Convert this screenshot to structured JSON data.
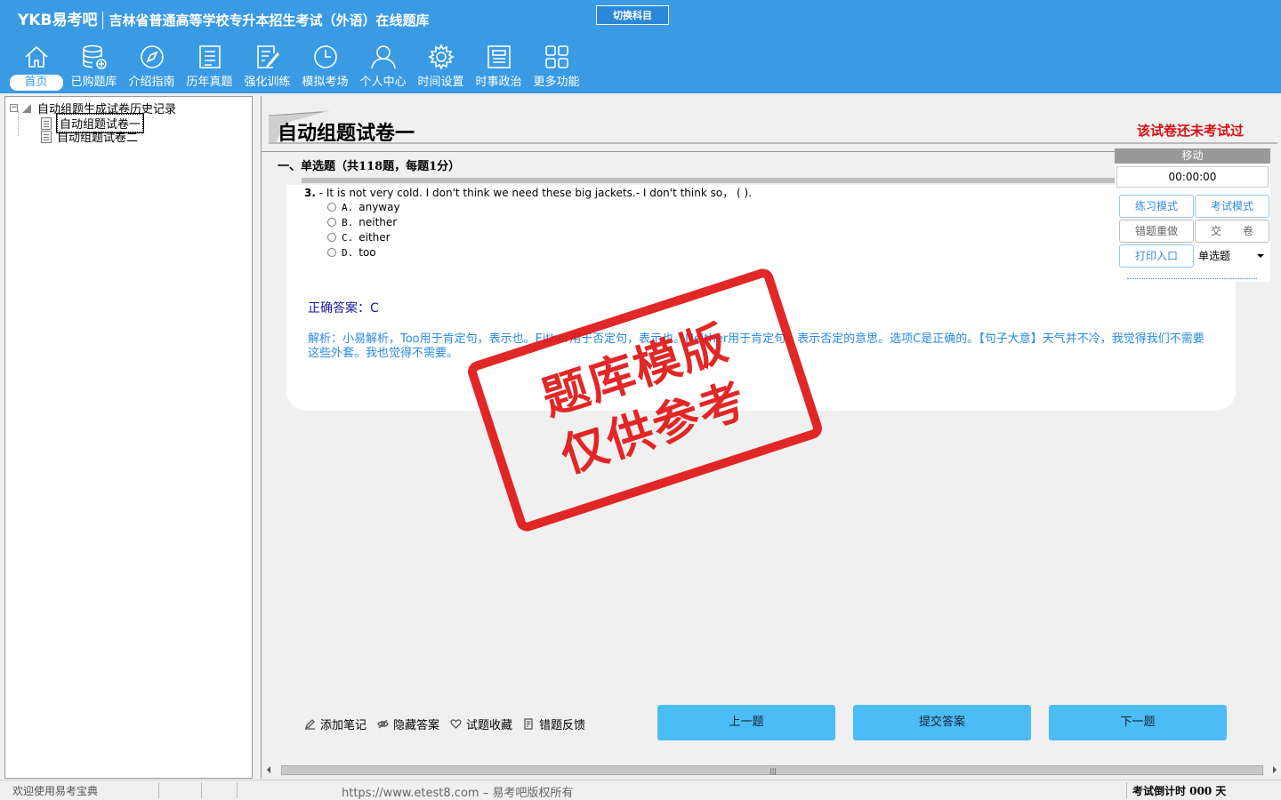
{
  "header": {
    "logo": "YKB易考吧",
    "title": "吉林省普通高等学校专升本招生考试（外语）在线题库",
    "switch_label": "切换科目"
  },
  "nav": [
    {
      "label": "首页",
      "icon": "home-icon",
      "active": true
    },
    {
      "label": "已购题库",
      "icon": "database-icon"
    },
    {
      "label": "介绍指南",
      "icon": "compass-icon"
    },
    {
      "label": "历年真题",
      "icon": "list-icon"
    },
    {
      "label": "强化训练",
      "icon": "edit-icon"
    },
    {
      "label": "模拟考场",
      "icon": "clock-icon"
    },
    {
      "label": "个人中心",
      "icon": "user-icon"
    },
    {
      "label": "时间设置",
      "icon": "gear-icon"
    },
    {
      "label": "时事政治",
      "icon": "news-icon"
    },
    {
      "label": "更多功能",
      "icon": "grid-icon"
    }
  ],
  "tree": {
    "root": "自动组题生成试卷历史记录",
    "items": [
      "自动组题试卷一",
      "自动组题试卷二"
    ]
  },
  "paper": {
    "title": "自动组题试卷一",
    "status": "该试卷还未考试过",
    "section": "一、单选题（共118题，每题1分）"
  },
  "question": {
    "number": "3.",
    "text": " - It is not very cold. I don't think we need these big jackets.- I don't think so， ( ).",
    "options": [
      {
        "letter": "A.",
        "text": "anyway"
      },
      {
        "letter": "B.",
        "text": "neither"
      },
      {
        "letter": "C.",
        "text": "either"
      },
      {
        "letter": "D.",
        "text": "too"
      }
    ],
    "answer": "正确答案：C",
    "analysis": "解析：小易解析，Too用于肯定句，表示也。Either用于否定句，表示也。Neither用于肯定句，表示否定的意思。选项C是正确的。【句子大意】天气并不冷，我觉得我们不需要这些外套。我也觉得不需要。"
  },
  "stamp": {
    "line1": "题库模版",
    "line2": "仅供参考"
  },
  "control": {
    "head": "移动",
    "timer": "00:00:00",
    "practice": "练习模式",
    "exam": "考试模式",
    "redo": "错题重做",
    "submit": "交　　卷",
    "print": "打印入口",
    "type": "单选题"
  },
  "tools": {
    "note": "添加笔记",
    "hide": "隐藏答案",
    "fav": "试题收藏",
    "report": "错题反馈"
  },
  "buttons": {
    "prev": "上一题",
    "submit": "提交答案",
    "next": "下一题"
  },
  "status": {
    "welcome": "欢迎使用易考宝典",
    "copyright": "https://www.etest8.com – 易考吧版权所有",
    "countdown": "考试倒计时 000 天"
  }
}
